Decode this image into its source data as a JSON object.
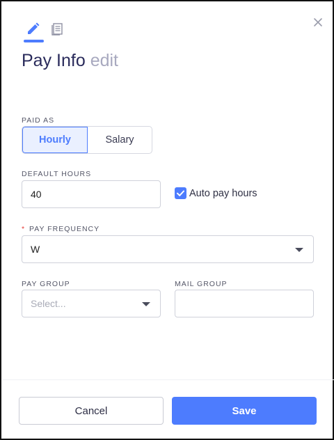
{
  "header": {
    "title_main": "Pay Info",
    "title_sub": "edit",
    "tabs": [
      {
        "icon": "pencil-icon",
        "active": true
      },
      {
        "icon": "document-icon",
        "active": false
      }
    ],
    "close_icon": "close-icon"
  },
  "form": {
    "paid_as": {
      "label": "PAID AS",
      "options": [
        "Hourly",
        "Salary"
      ],
      "selected": "Hourly"
    },
    "default_hours": {
      "label": "DEFAULT HOURS",
      "value": "40"
    },
    "auto_pay_hours": {
      "label": "Auto pay hours",
      "checked": true
    },
    "pay_frequency": {
      "required_mark": "*",
      "label": "PAY FREQUENCY",
      "value": "W"
    },
    "pay_group": {
      "label": "PAY GROUP",
      "placeholder": "Select..."
    },
    "mail_group": {
      "label": "MAIL GROUP",
      "value": ""
    }
  },
  "footer": {
    "cancel_label": "Cancel",
    "save_label": "Save"
  },
  "colors": {
    "accent": "#4d7cfe",
    "title": "#2a2b5b",
    "subtitle": "#a8a9bf",
    "required": "#e53935"
  }
}
